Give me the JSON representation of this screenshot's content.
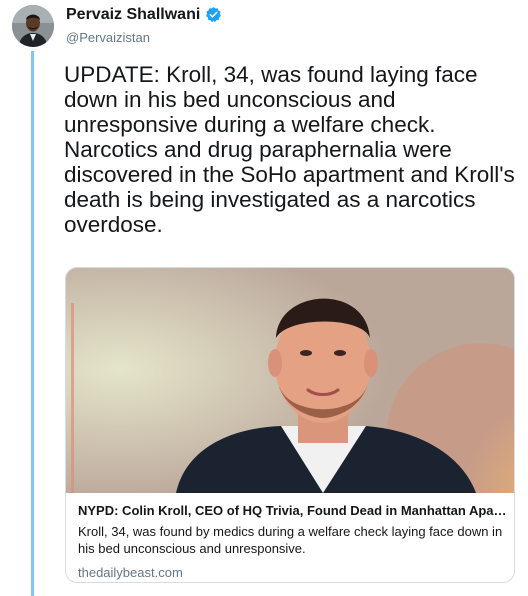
{
  "author": {
    "name": "Pervaiz Shallwani",
    "handle": "@Pervaizistan",
    "verified": true,
    "avatar_icon": "avatar-photo",
    "verified_icon": "verified-badge-icon"
  },
  "tweet": {
    "text": "UPDATE: Kroll, 34, was found laying face down in his bed unconscious and unresponsive during a welfare check. Narcotics and drug paraphernalia were discovered in the SoHo apartment and Kroll's death is being investigated as a narcotics overdose."
  },
  "link_card": {
    "title": "NYPD: Colin Kroll, CEO of HQ Trivia, Found Dead in Manhattan Apart...",
    "description": "Kroll, 34, was found by medics during a welfare check laying face down in his bed unconscious and unresponsive.",
    "domain": "thedailybeast.com"
  },
  "colors": {
    "thread_line": "#7fc7ee",
    "verified_blue": "#1da1f2",
    "secondary_text": "#657786",
    "card_border": "#d6dde3"
  }
}
